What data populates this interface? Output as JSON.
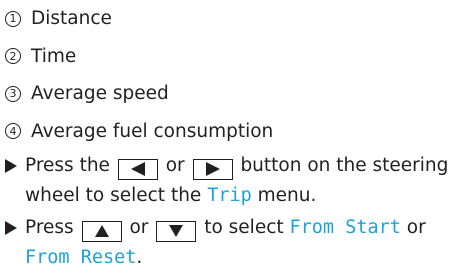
{
  "legend": [
    {
      "num": "1",
      "label": "Distance"
    },
    {
      "num": "2",
      "label": "Time"
    },
    {
      "num": "3",
      "label": "Average speed"
    },
    {
      "num": "4",
      "label": "Average fuel consumption"
    }
  ],
  "step1": {
    "prefix": "Press the",
    "or": "or",
    "suffix": "button on the steering wheel to select the",
    "menu": "Trip",
    "end": "menu.",
    "left_icon": "left-arrow-key-icon",
    "right_icon": "right-arrow-key-icon"
  },
  "step2": {
    "prefix": "Press",
    "or": "or",
    "middle": "to select",
    "option_a": "From Start",
    "or2": "or",
    "option_b": "From Reset",
    "end": ".",
    "up_icon": "up-arrow-key-icon",
    "down_icon": "down-arrow-key-icon"
  },
  "colors": {
    "text": "#231f20",
    "highlight": "#1aa3d9"
  }
}
